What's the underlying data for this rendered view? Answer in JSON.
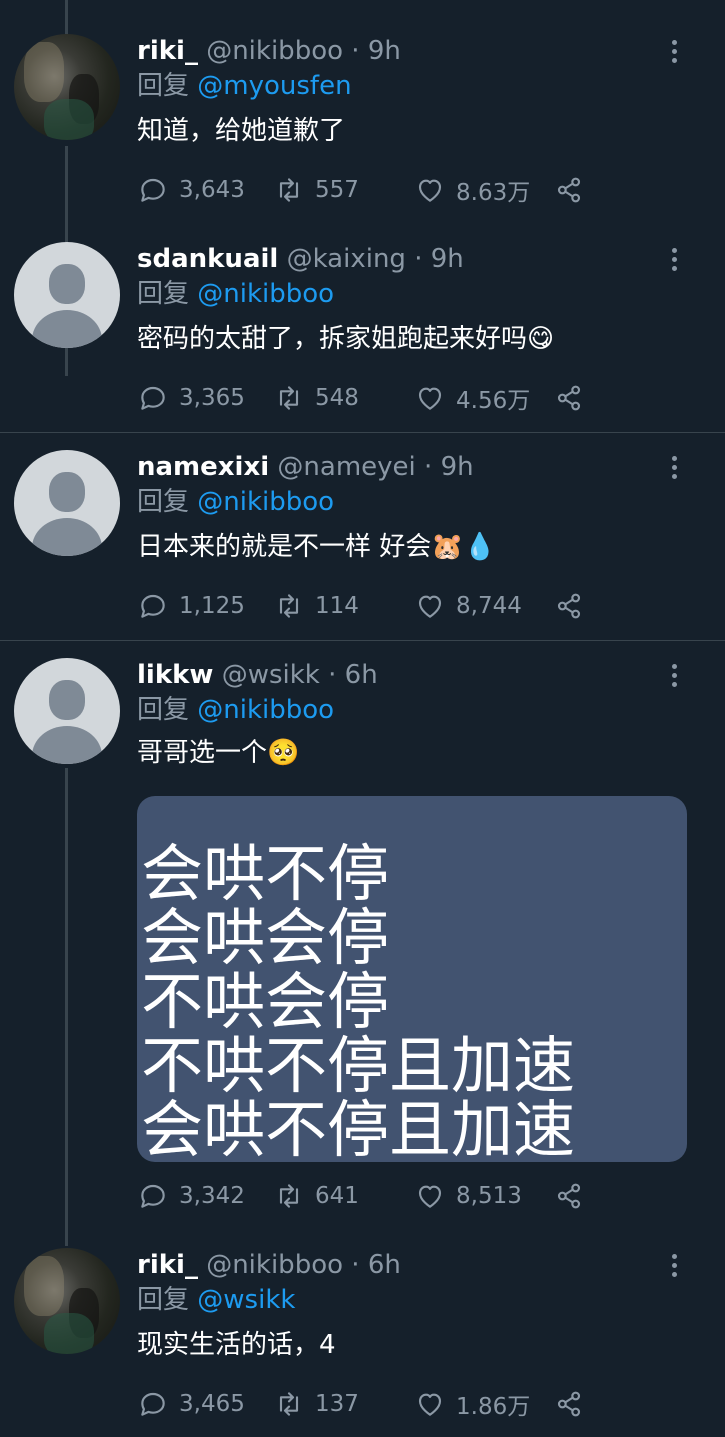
{
  "tweets": [
    {
      "name": "riki_",
      "handle": "@nikibboo",
      "time": "9h",
      "reply_label": "回复",
      "reply_to": "@myousfen",
      "text": "知道，给她道歉了",
      "replies": "3,643",
      "retweets": "557",
      "likes": "8.63万",
      "avatar": "photo"
    },
    {
      "name": "sdankuail",
      "handle": "@kaixing",
      "time": "9h",
      "reply_label": "回复",
      "reply_to": "@nikibboo",
      "text": "密码的太甜了，拆家姐跑起来好吗😋",
      "replies": "3,365",
      "retweets": "548",
      "likes": "4.56万",
      "avatar": "default"
    },
    {
      "name": "namexixi",
      "handle": "@nameyei",
      "time": "9h",
      "reply_label": "回复",
      "reply_to": "@nikibboo",
      "text": "日本来的就是不一样 好会🐹💧",
      "replies": "1,125",
      "retweets": "114",
      "likes": "8,744",
      "avatar": "default"
    },
    {
      "name": "likkw",
      "handle": "@wsikk",
      "time": "6h",
      "reply_label": "回复",
      "reply_to": "@nikibboo",
      "text": "哥哥选一个🥺",
      "replies": "3,342",
      "retweets": "641",
      "likes": "8,513",
      "avatar": "default",
      "media_lines": [
        "会哄不停",
        "会哄会停",
        "不哄会停",
        "不哄不停且加速",
        "会哄不停且加速"
      ]
    },
    {
      "name": "riki_",
      "handle": "@nikibboo",
      "time": "6h",
      "reply_label": "回复",
      "reply_to": "@wsikk",
      "text": "现实生活的话，4",
      "replies": "3,465",
      "retweets": "137",
      "likes": "1.86万",
      "avatar": "photo"
    }
  ],
  "separator": "·",
  "colors": {
    "background": "#15202b",
    "secondary_text": "#8b98a5",
    "link": "#1d9bf0",
    "divider": "#38444d",
    "media_bg": "#425370"
  },
  "icons": [
    "reply-icon",
    "retweet-icon",
    "like-icon",
    "share-icon",
    "more-icon"
  ]
}
